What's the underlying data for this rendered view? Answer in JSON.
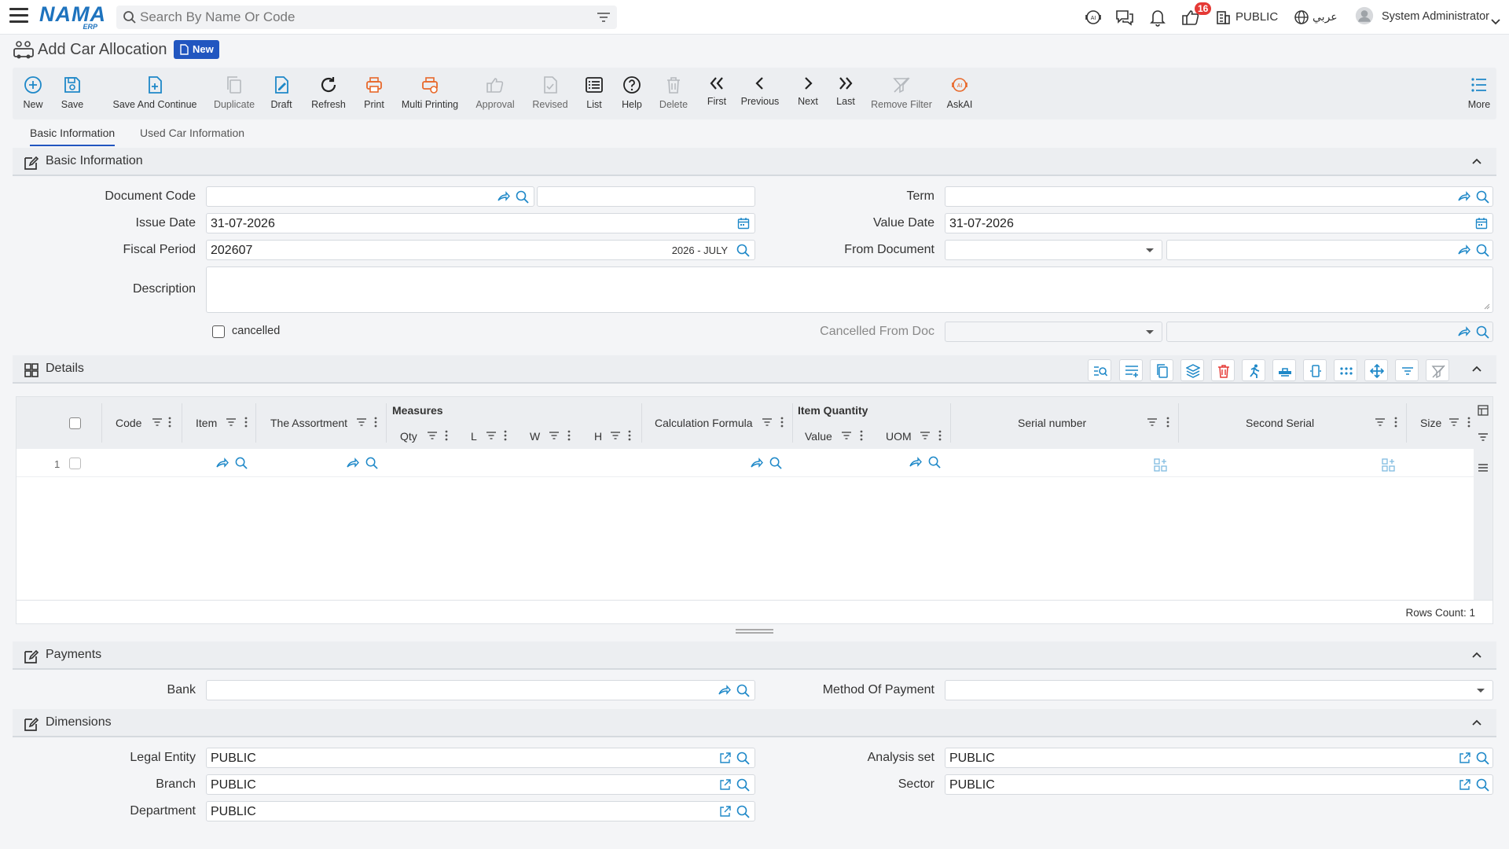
{
  "topbar": {
    "search_placeholder": "Search By Name Or Code",
    "notification_count": "16",
    "company": "PUBLIC",
    "language": "عربي",
    "user": "System Administrator",
    "logo": "NAMA",
    "logo_sub": "ERP"
  },
  "page": {
    "title": "Add Car Allocation",
    "status": "New"
  },
  "toolbar": {
    "new": "New",
    "save": "Save",
    "save_continue": "Save And Continue",
    "duplicate": "Duplicate",
    "draft": "Draft",
    "refresh": "Refresh",
    "print": "Print",
    "multi_printing": "Multi Printing",
    "approval": "Approval",
    "revised": "Revised",
    "list": "List",
    "help": "Help",
    "delete": "Delete",
    "first": "First",
    "previous": "Previous",
    "next": "Next",
    "last": "Last",
    "remove_filter": "Remove Filter",
    "askai": "AskAI",
    "more": "More"
  },
  "tabs": [
    "Basic Information",
    "Used Car Information"
  ],
  "basic": {
    "title": "Basic Information",
    "document_code_label": "Document Code",
    "document_code": "",
    "term_label": "Term",
    "issue_date_label": "Issue Date",
    "issue_date": "31-07-2026",
    "value_date_label": "Value Date",
    "value_date": "31-07-2026",
    "fiscal_period_label": "Fiscal Period",
    "fiscal_period": "202607",
    "fiscal_period_name": "2026 - JULY",
    "from_document_label": "From Document",
    "description_label": "Description",
    "cancelled_label": "cancelled",
    "cancelled_from_doc_label": "Cancelled From Doc"
  },
  "details": {
    "title": "Details",
    "columns": {
      "code": "Code",
      "item": "Item",
      "assortment": "The Assortment",
      "measures": "Measures",
      "qty": "Qty",
      "l": "L",
      "w": "W",
      "h": "H",
      "calc_formula": "Calculation Formula",
      "item_quantity": "Item Quantity",
      "value": "Value",
      "uom": "UOM",
      "serial": "Serial number",
      "second_serial": "Second Serial",
      "size": "Size"
    },
    "row_number": "1",
    "rows_count": "Rows Count: 1"
  },
  "payments": {
    "title": "Payments",
    "bank_label": "Bank",
    "method_label": "Method Of Payment"
  },
  "dimensions": {
    "title": "Dimensions",
    "legal_entity_label": "Legal Entity",
    "legal_entity": "PUBLIC",
    "analysis_set_label": "Analysis set",
    "analysis_set": "PUBLIC",
    "branch_label": "Branch",
    "branch": "PUBLIC",
    "sector_label": "Sector",
    "sector": "PUBLIC",
    "department_label": "Department",
    "department": "PUBLIC"
  },
  "colors": {
    "accent": "#2156c0",
    "icon_blue": "#1e88c8",
    "print_orange": "#e8682a",
    "delete_red": "#e53935"
  }
}
